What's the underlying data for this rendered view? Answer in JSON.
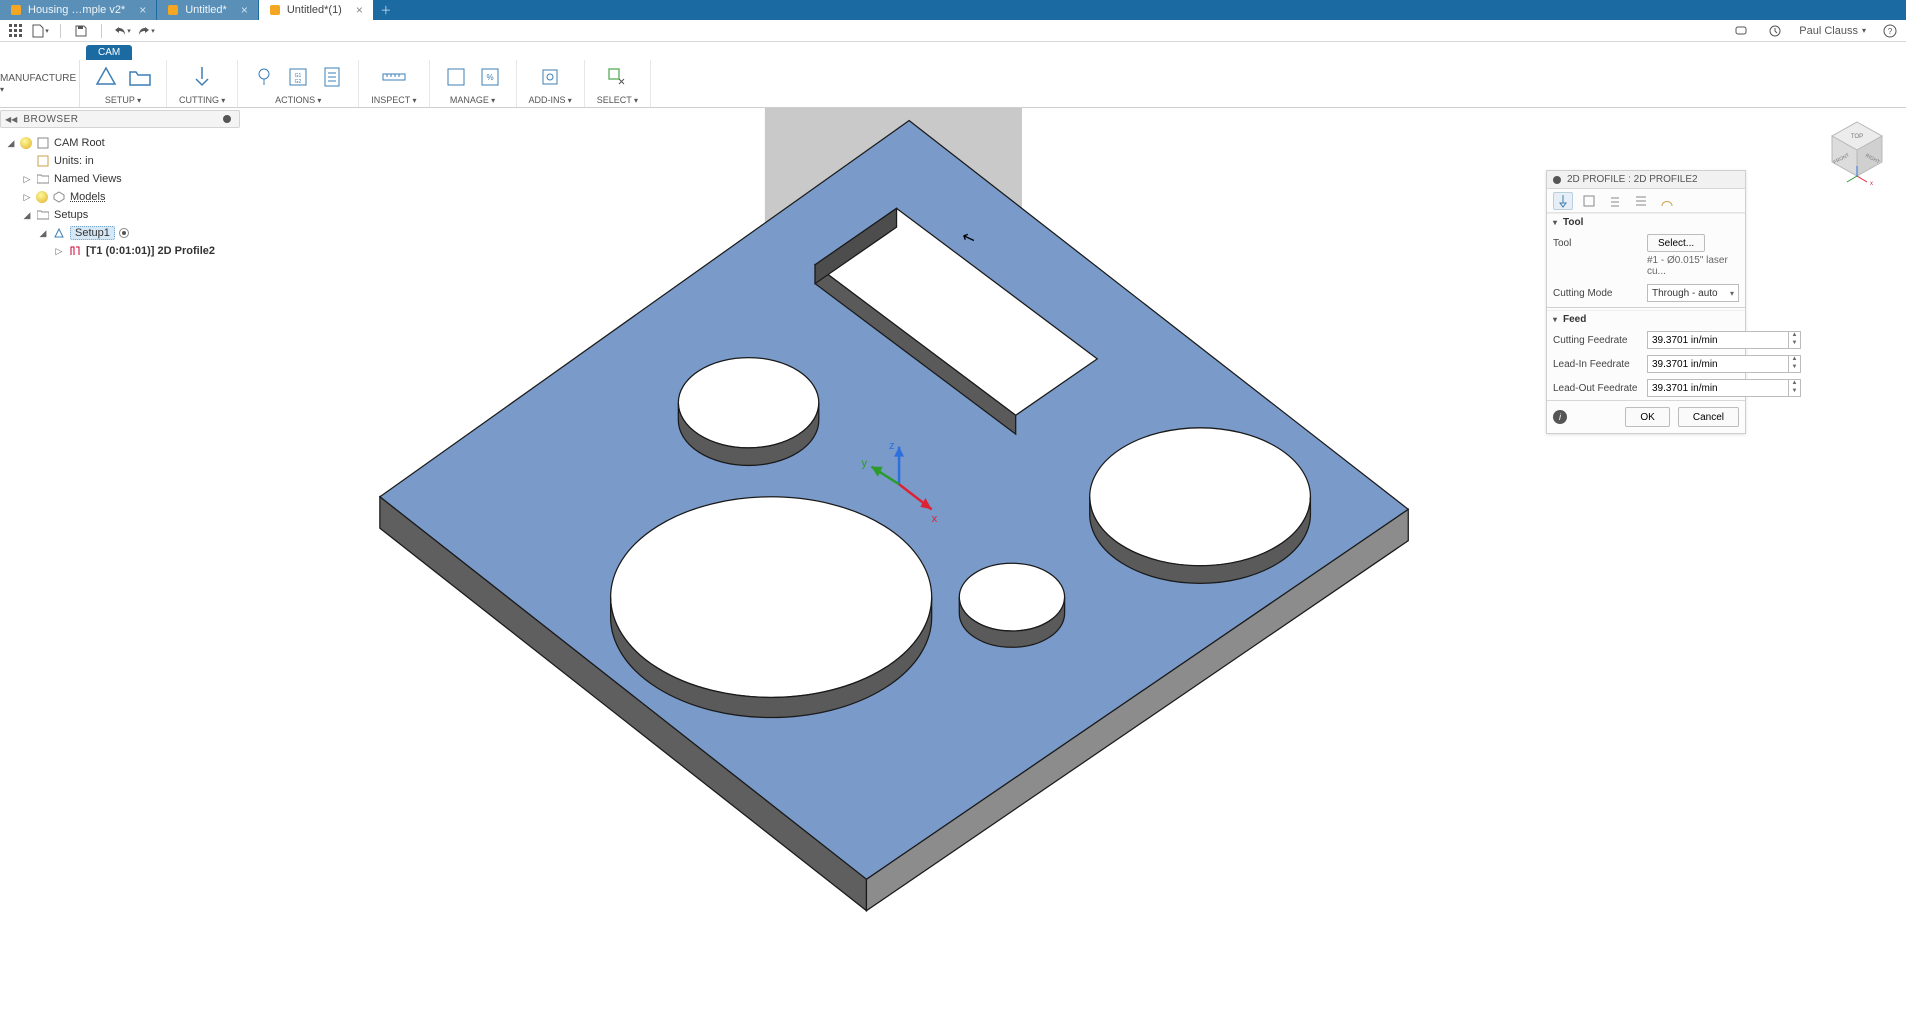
{
  "tabs": [
    {
      "label": "Housing …mple v2*",
      "active": false
    },
    {
      "label": "Untitled*",
      "active": false
    },
    {
      "label": "Untitled*(1)",
      "active": true
    }
  ],
  "user_name": "Paul Clauss",
  "workspace": {
    "tab": "CAM",
    "selector": "MANUFACTURE"
  },
  "ribbon": [
    {
      "label": "SETUP"
    },
    {
      "label": "CUTTING"
    },
    {
      "label": "ACTIONS"
    },
    {
      "label": "INSPECT"
    },
    {
      "label": "MANAGE"
    },
    {
      "label": "ADD-INS"
    },
    {
      "label": "SELECT"
    }
  ],
  "browser": {
    "title": "BROWSER",
    "root": "CAM Root",
    "units": "Units: in",
    "named_views": "Named Views",
    "models": "Models",
    "setups": "Setups",
    "setup1": "Setup1",
    "op1": "[T1 (0:01:01)] 2D Profile2"
  },
  "viewcube": {
    "top": "TOP",
    "front": "FRONT",
    "right": "RIGHT"
  },
  "panel": {
    "title": "2D PROFILE : 2D PROFILE2",
    "sections": {
      "tool": {
        "header": "Tool",
        "tool_label": "Tool",
        "select": "Select...",
        "tool_desc": "#1 - Ø0.015\" laser cu...",
        "cutting_mode_label": "Cutting Mode",
        "cutting_mode_value": "Through - auto"
      },
      "feed": {
        "header": "Feed",
        "cutting_label": "Cutting Feedrate",
        "cutting_value": "39.3701 in/min",
        "leadin_label": "Lead-In Feedrate",
        "leadin_value": "39.3701 in/min",
        "leadout_label": "Lead-Out Feedrate",
        "leadout_value": "39.3701 in/min"
      }
    },
    "ok": "OK",
    "cancel": "Cancel"
  },
  "triad": {
    "x": "x",
    "y": "y",
    "z": "z"
  }
}
